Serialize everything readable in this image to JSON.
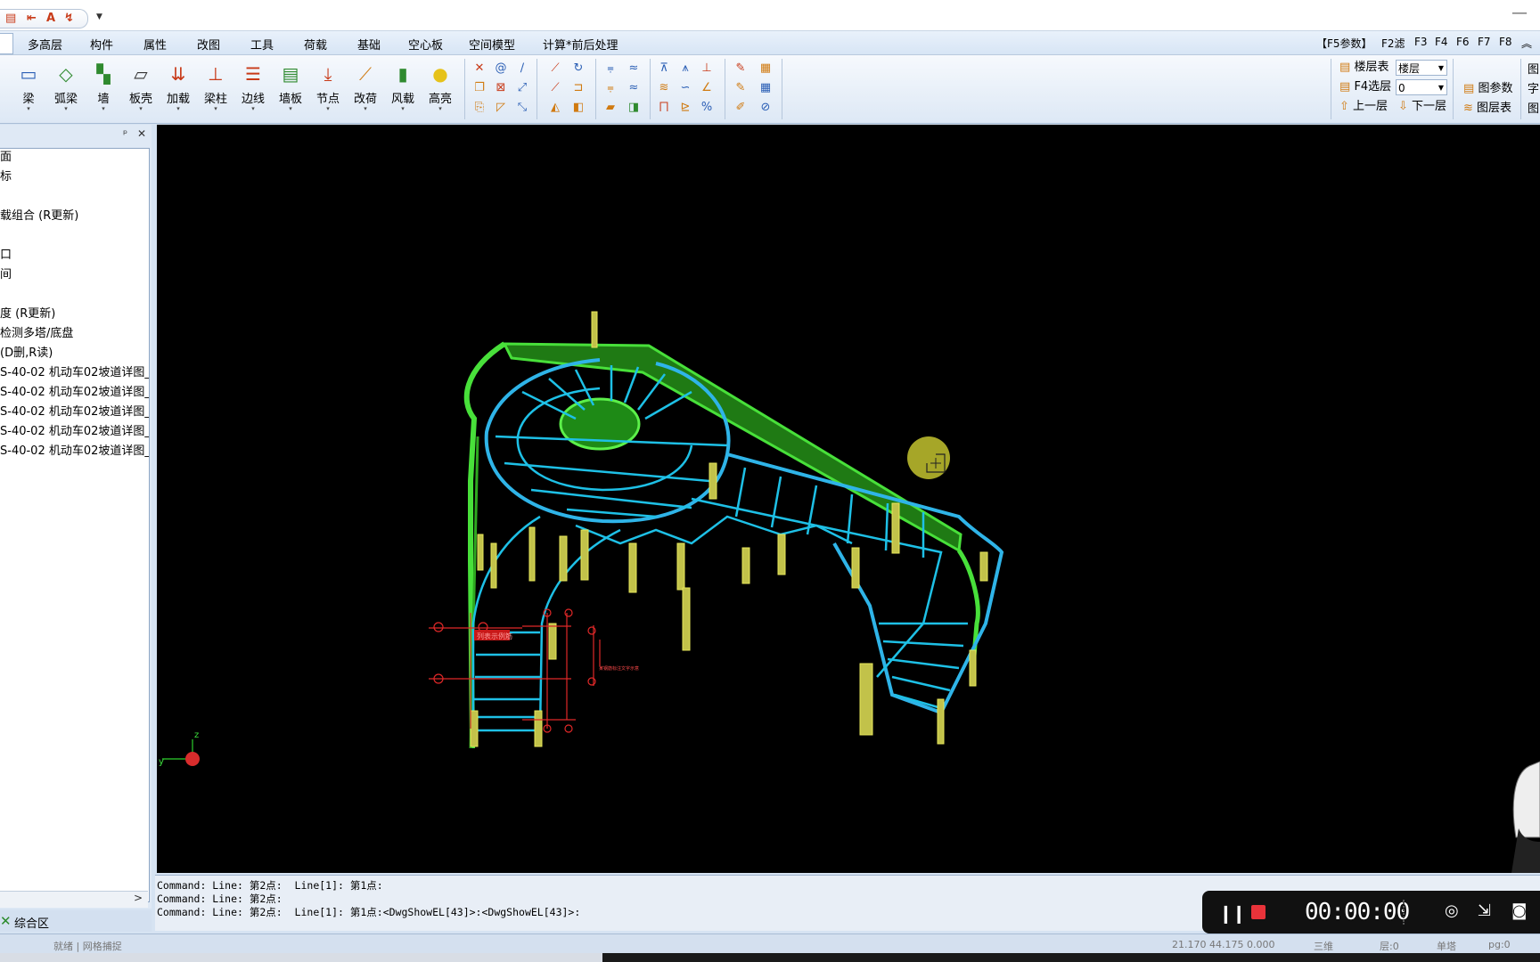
{
  "menu": {
    "items": [
      "多高层",
      "构件",
      "属性",
      "改图",
      "工具",
      "荷载",
      "基础",
      "空心板",
      "空间模型",
      "计算*前后处理"
    ],
    "fkeys": [
      "【F5参数】",
      "F2滤",
      "F3",
      "F4",
      "F6",
      "F7",
      "F8",
      "︽"
    ]
  },
  "ribbon": {
    "buttons": [
      {
        "label": "梁",
        "icon": "beam-icon",
        "glyph": "▭",
        "color": "#2b5fb5"
      },
      {
        "label": "弧梁",
        "icon": "arc-beam-icon",
        "glyph": "◇",
        "color": "#2f8a2f"
      },
      {
        "label": "墙",
        "icon": "wall-icon",
        "glyph": "▚",
        "color": "#2f8a2f"
      },
      {
        "label": "板壳",
        "icon": "slab-icon",
        "glyph": "▱",
        "color": "#333"
      },
      {
        "label": "加载",
        "icon": "load-icon",
        "glyph": "⇊",
        "color": "#c83a18"
      },
      {
        "label": "梁柱",
        "icon": "beam-column-icon",
        "glyph": "⊥",
        "color": "#c83a18"
      },
      {
        "label": "边线",
        "icon": "edge-line-icon",
        "glyph": "☰",
        "color": "#c83a18"
      },
      {
        "label": "墙板",
        "icon": "wall-panel-icon",
        "glyph": "▤",
        "color": "#2f8a2f"
      },
      {
        "label": "节点",
        "icon": "node-icon",
        "glyph": "⤓",
        "color": "#c83a18"
      },
      {
        "label": "改荷",
        "icon": "modify-load-icon",
        "glyph": "⟋",
        "color": "#d07a10"
      },
      {
        "label": "风载",
        "icon": "wind-load-icon",
        "glyph": "▮",
        "color": "#2f8a2f"
      },
      {
        "label": "高亮",
        "icon": "bulb-icon",
        "glyph": "●",
        "color": "#e6c21a"
      }
    ],
    "floor_panel": {
      "row1_label": "楼层表",
      "row1_value": "楼层",
      "row2_label": "F4选层",
      "row2_value": "0",
      "up_label": "上一层",
      "down_label": "下一层"
    },
    "right_panel": {
      "params": "图参数",
      "layers": "图层表"
    },
    "edge_labels": [
      "图",
      "字",
      "图"
    ]
  },
  "tree": {
    "items": [
      "面",
      "标",
      "",
      "载组合 (R更新)",
      "",
      "口",
      "间",
      "",
      "度 (R更新)",
      "检测多塔/底盘",
      " (D删,R读)",
      "S-40-02 机动车02坡道详图_",
      "S-40-02 机动车02坡道详图_",
      "S-40-02 机动车02坡道详图_",
      "S-40-02 机动车02坡道详图_",
      "S-40-02 机动车02坡道详图_"
    ],
    "scroll_arrow": ">"
  },
  "bottom_tab": {
    "label": "综合区"
  },
  "drawing": {
    "axis_label_z": "z",
    "axis_label_y": "y",
    "annotation_text": "列表示例筋",
    "annotation_side": "某钢筋标注文字示意"
  },
  "command": {
    "lines": [
      "Command: Line: 第2点:  Line[1]: 第1点:",
      "Command: Line: 第2点:",
      "Command: Line: 第2点:  Line[1]: 第1点:<DwgShowEL[43]>:<DwgShowEL[43]>:"
    ]
  },
  "status": {
    "coords": "21.170  44.175  0.000",
    "view": "三维",
    "layer": "层:0",
    "tower": "单塔",
    "pg": "pg:0",
    "left": "就绪 | 网格捕捉"
  },
  "recorder": {
    "time": "00:00:00"
  }
}
